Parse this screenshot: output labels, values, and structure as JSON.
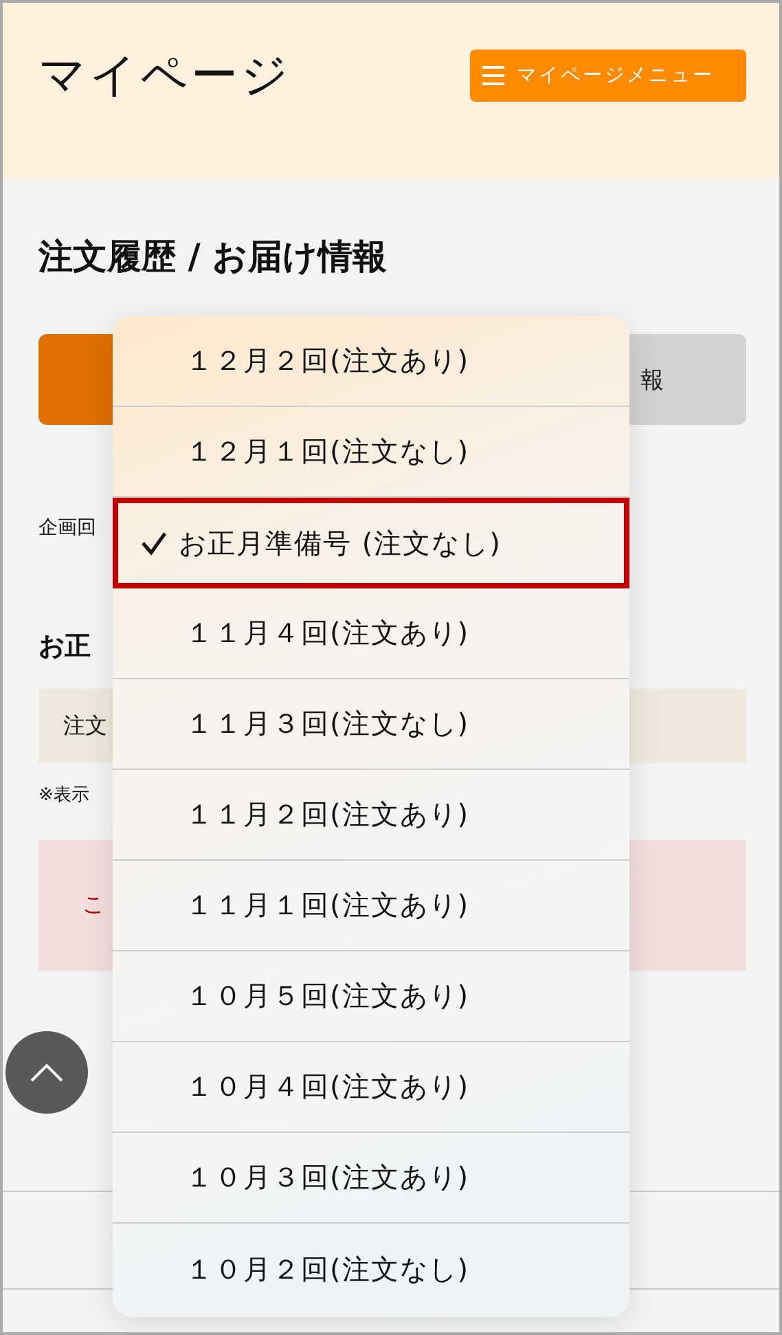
{
  "header": {
    "title": "マイページ",
    "menu_button": "マイページメニュー"
  },
  "heading": "注文履歴 / お届け情報",
  "tabs": [
    {
      "selected": true
    },
    {
      "label": "報",
      "selected": false
    }
  ],
  "issue_label": "企画回",
  "section_title": "お正",
  "order_box": "注文",
  "note": "※表示",
  "alert_text": "こ",
  "dropdown": {
    "options": [
      {
        "label": "１２月２回(注文あり)",
        "selected": false
      },
      {
        "label": "１２月１回(注文なし)",
        "selected": false
      },
      {
        "label": "お正月準備号 (注文なし)",
        "selected": true
      },
      {
        "label": "１１月４回(注文あり)",
        "selected": false
      },
      {
        "label": "１１月３回(注文なし)",
        "selected": false
      },
      {
        "label": "１１月２回(注文あり)",
        "selected": false
      },
      {
        "label": "１１月１回(注文あり)",
        "selected": false
      },
      {
        "label": "１０月５回(注文あり)",
        "selected": false
      },
      {
        "label": "１０月４回(注文あり)",
        "selected": false
      },
      {
        "label": "１０月３回(注文あり)",
        "selected": false
      },
      {
        "label": "１０月２回(注文なし)",
        "selected": false
      }
    ]
  }
}
